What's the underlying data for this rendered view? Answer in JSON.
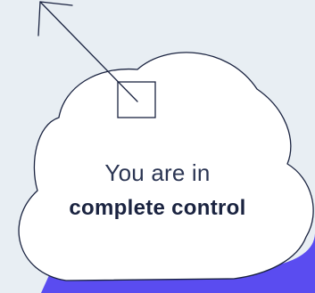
{
  "message": {
    "line1": "You are in",
    "line2": "complete control"
  },
  "colors": {
    "background": "#e8eef3",
    "cloud_fill": "#ffffff",
    "outline": "#1a2340",
    "accent_shape": "#5a4cf0"
  },
  "icons": {
    "cursor": "resize-arrow-icon",
    "handle": "square-handle-icon"
  }
}
